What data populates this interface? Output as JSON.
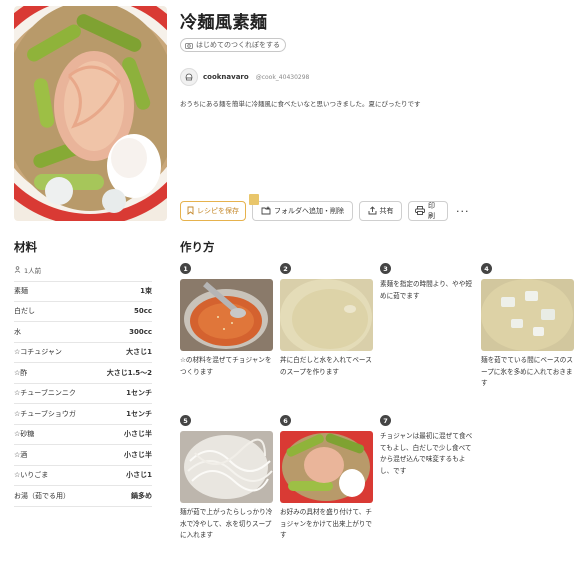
{
  "recipe": {
    "title": "冷麺風素麺",
    "report_button": "はじめてのつくれぽをする",
    "author_name": "cooknavaro",
    "author_id": "@cook_40430298",
    "description": "おうちにある麺を簡単に冷麺風に食べたいなと思いつきました。夏にぴったりです"
  },
  "actions": {
    "save": "レシピを保存",
    "folder": "フォルダへ追加・削除",
    "share": "共有",
    "print": "印刷",
    "more": "···"
  },
  "ingredients": {
    "heading": "材料",
    "servings": "1人前",
    "items": [
      {
        "name": "素麺",
        "amount": "1束"
      },
      {
        "name": "白だし",
        "amount": "50cc"
      },
      {
        "name": "水",
        "amount": "300cc"
      },
      {
        "name": "☆コチュジャン",
        "amount": "大さじ1"
      },
      {
        "name": "☆酢",
        "amount": "大さじ1.5〜2"
      },
      {
        "name": "☆チューブニンニク",
        "amount": "1センチ"
      },
      {
        "name": "☆チューブショウガ",
        "amount": "1センチ"
      },
      {
        "name": "☆砂糖",
        "amount": "小さじ半"
      },
      {
        "name": "☆酒",
        "amount": "小さじ半"
      },
      {
        "name": "☆いりごま",
        "amount": "小さじ1"
      },
      {
        "name": "お湯（茹でる用）",
        "amount": "鍋多め"
      }
    ]
  },
  "steps": {
    "heading": "作り方",
    "items": [
      {
        "num": "1",
        "text": "☆の材料を混ぜてチョジャンをつくります"
      },
      {
        "num": "2",
        "text": "丼に白だしと水を入れてベースのスープを作ります"
      },
      {
        "num": "3",
        "text": "素麺を指定の時間より、やや短めに茹でます"
      },
      {
        "num": "4",
        "text": "麺を茹でている間にベースのスープに氷を多めに入れておきます"
      },
      {
        "num": "5",
        "text": "麺が茹で上がったらしっかり冷水で冷やして、水を切りスープに入れます"
      },
      {
        "num": "6",
        "text": "お好みの具材を盛り付けて、チョジャンをかけて出来上がりです"
      },
      {
        "num": "7",
        "text": "チョジャンは最初に混ぜて食べてもよし、白だしで少し食べてから混ぜ込んで味変するもよし、です"
      }
    ]
  },
  "colors": {
    "accent": "#e6b24d",
    "badge": "#444444"
  }
}
